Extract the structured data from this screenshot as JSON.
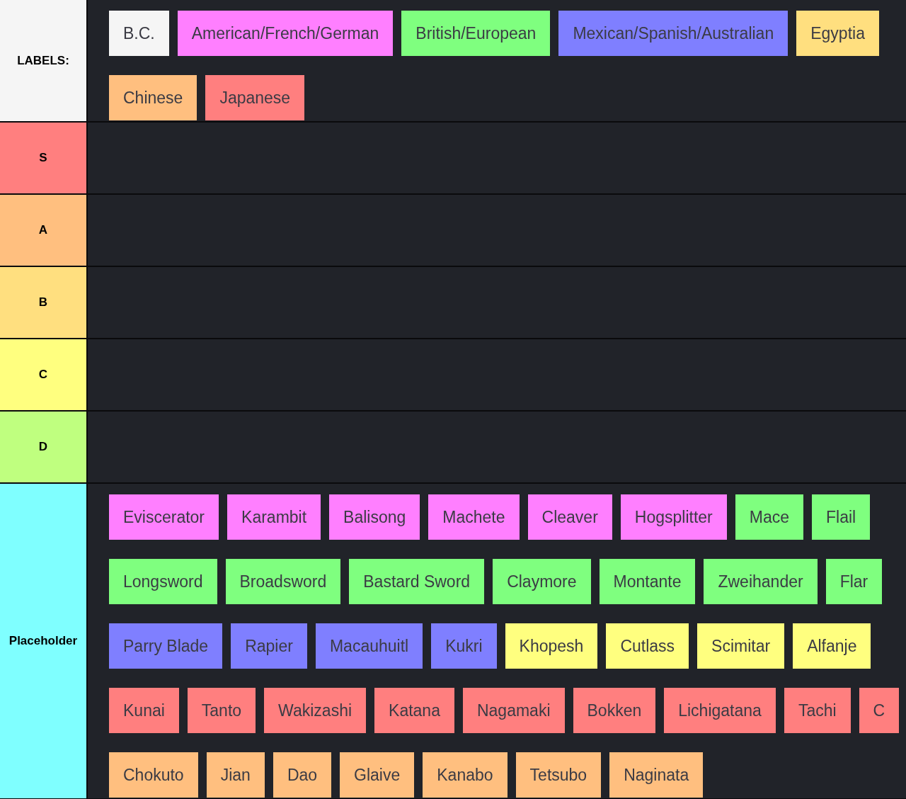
{
  "tiers": [
    {
      "label": "LABELS:",
      "color": "#f5f5f5",
      "lines": [
        [
          {
            "label": "B.C.",
            "color": "#f5f5f5"
          },
          {
            "label": "American/French/German",
            "color": "#ff7fff"
          },
          {
            "label": "British/European",
            "color": "#7fff7f"
          },
          {
            "label": "Mexican/Spanish/Australian",
            "color": "#7f7fff"
          },
          {
            "label": "Egyptia",
            "color": "#ffdf7f"
          }
        ],
        [
          {
            "label": "Chinese",
            "color": "#ffbf7f"
          },
          {
            "label": "Japanese",
            "color": "#ff7f7f"
          }
        ]
      ]
    },
    {
      "label": "S",
      "color": "#ff7f7f"
    },
    {
      "label": "A",
      "color": "#ffbf7f"
    },
    {
      "label": "B",
      "color": "#ffdf7f"
    },
    {
      "label": "C",
      "color": "#ffff7f"
    },
    {
      "label": "D",
      "color": "#bfff7f"
    },
    {
      "label": "Placeholder",
      "color": "#7fffff",
      "lines": [
        [
          {
            "label": "Eviscerator",
            "color": "#ff7fff"
          },
          {
            "label": "Karambit",
            "color": "#ff7fff"
          },
          {
            "label": "Balisong",
            "color": "#ff7fff"
          },
          {
            "label": "Machete",
            "color": "#ff7fff"
          },
          {
            "label": "Cleaver",
            "color": "#ff7fff"
          },
          {
            "label": "Hogsplitter",
            "color": "#ff7fff"
          },
          {
            "label": "Mace",
            "color": "#7fff7f"
          },
          {
            "label": "Flail",
            "color": "#7fff7f"
          }
        ],
        [
          {
            "label": "Longsword",
            "color": "#7fff7f"
          },
          {
            "label": "Broadsword",
            "color": "#7fff7f"
          },
          {
            "label": "Bastard Sword",
            "color": "#7fff7f"
          },
          {
            "label": "Claymore",
            "color": "#7fff7f"
          },
          {
            "label": "Montante",
            "color": "#7fff7f"
          },
          {
            "label": "Zweihander",
            "color": "#7fff7f"
          },
          {
            "label": "Flar",
            "color": "#7fff7f"
          }
        ],
        [
          {
            "label": "Parry Blade",
            "color": "#7f7fff"
          },
          {
            "label": "Rapier",
            "color": "#7f7fff"
          },
          {
            "label": "Macauhuitl",
            "color": "#7f7fff"
          },
          {
            "label": "Kukri",
            "color": "#7f7fff"
          },
          {
            "label": "Khopesh",
            "color": "#ffff7f"
          },
          {
            "label": "Cutlass",
            "color": "#ffff7f"
          },
          {
            "label": "Scimitar",
            "color": "#ffff7f"
          },
          {
            "label": "Alfanje",
            "color": "#ffff7f"
          }
        ],
        [
          {
            "label": "Kunai",
            "color": "#ff7f7f"
          },
          {
            "label": "Tanto",
            "color": "#ff7f7f"
          },
          {
            "label": "Wakizashi",
            "color": "#ff7f7f"
          },
          {
            "label": "Katana",
            "color": "#ff7f7f"
          },
          {
            "label": "Nagamaki",
            "color": "#ff7f7f"
          },
          {
            "label": "Bokken",
            "color": "#ff7f7f"
          },
          {
            "label": "Lichigatana",
            "color": "#ff7f7f"
          },
          {
            "label": "Tachi",
            "color": "#ff7f7f"
          },
          {
            "label": "C",
            "color": "#ff7f7f"
          }
        ],
        [
          {
            "label": "Chokuto",
            "color": "#ffbf7f"
          },
          {
            "label": "Jian",
            "color": "#ffbf7f"
          },
          {
            "label": "Dao",
            "color": "#ffbf7f"
          },
          {
            "label": "Glaive",
            "color": "#ffbf7f"
          },
          {
            "label": "Kanabo",
            "color": "#ffbf7f"
          },
          {
            "label": "Tetsubo",
            "color": "#ffbf7f"
          },
          {
            "label": "Naginata",
            "color": "#ffbf7f"
          }
        ]
      ]
    }
  ]
}
